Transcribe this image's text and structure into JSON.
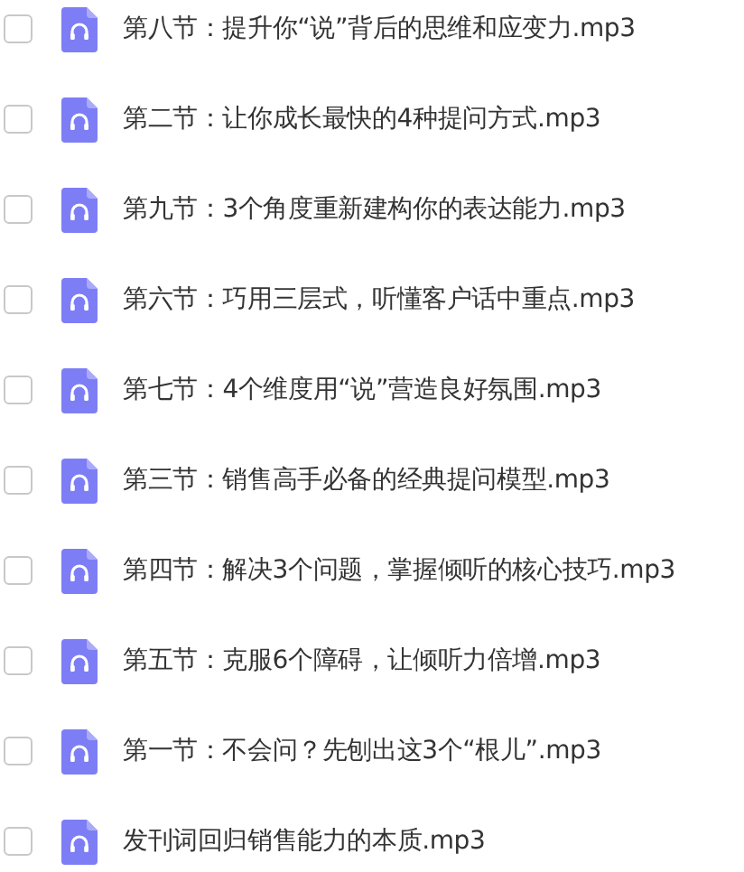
{
  "files": [
    {
      "name": "第八节：提升你“说”背后的思维和应变力.mp3",
      "checked": false
    },
    {
      "name": "第二节：让你成长最快的4种提问方式.mp3",
      "checked": false
    },
    {
      "name": "第九节：3个角度重新建构你的表达能力.mp3",
      "checked": false
    },
    {
      "name": "第六节：巧用三层式，听懂客户话中重点.mp3",
      "checked": false
    },
    {
      "name": "第七节：4个维度用“说”营造良好氛围.mp3",
      "checked": false
    },
    {
      "name": "第三节：销售高手必备的经典提问模型.mp3",
      "checked": false
    },
    {
      "name": "第四节：解决3个问题，掌握倾听的核心技巧.mp3",
      "checked": false
    },
    {
      "name": "第五节：克服6个障碍，让倾听力倍增.mp3",
      "checked": false
    },
    {
      "name": "第一节：不会问？先刨出这3个“根儿”.mp3",
      "checked": false
    },
    {
      "name": "发刊词回归销售能力的本质.mp3",
      "checked": false
    }
  ]
}
